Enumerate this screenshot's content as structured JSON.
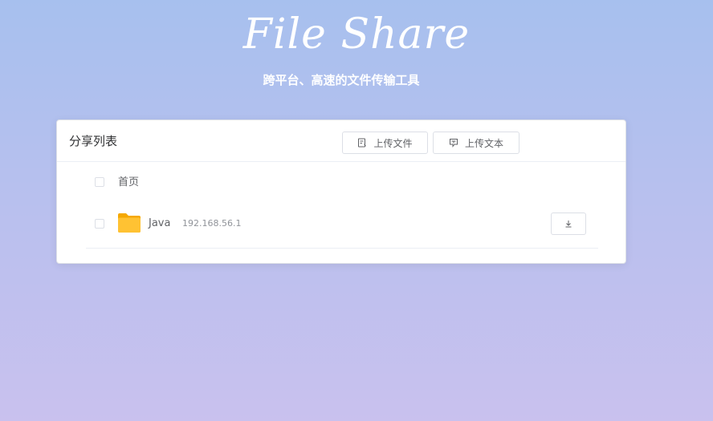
{
  "app": {
    "title": "File Share",
    "subtitle": "跨平台、高速的文件传输工具"
  },
  "share_list": {
    "title": "分享列表",
    "upload_file_label": "上传文件",
    "upload_text_label": "上传文本",
    "home_label": "首页",
    "items": [
      {
        "name": "Java",
        "ip": "192.168.56.1",
        "type": "folder",
        "icon": "folder-icon"
      }
    ]
  },
  "colors": {
    "background_top": "#a7c0ee",
    "background_bottom": "#c9c1ee",
    "folder": "#ffc233"
  }
}
